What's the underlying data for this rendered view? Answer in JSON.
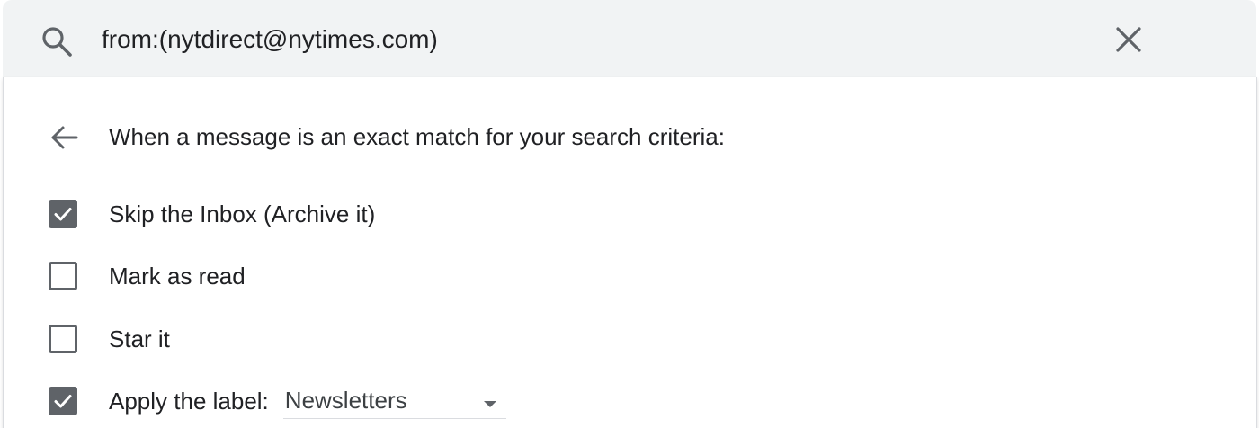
{
  "search": {
    "query": "from:(nytdirect@nytimes.com)",
    "search_icon": "search-icon",
    "clear_icon": "close-icon"
  },
  "filter": {
    "back_icon": "arrow-back-icon",
    "criteria_text": "When a message is an exact match for your search criteria:",
    "options": [
      {
        "label": "Skip the Inbox (Archive it)",
        "checked": true
      },
      {
        "label": "Mark as read",
        "checked": false
      },
      {
        "label": "Star it",
        "checked": false
      },
      {
        "label": "Apply the label:",
        "checked": true
      }
    ],
    "label_select": {
      "value": "Newsletters",
      "icon": "chevron-down-icon"
    }
  },
  "colors": {
    "search_bg": "#f1f3f4",
    "text": "#202124",
    "icon": "#5f6368",
    "divider": "#dadce0"
  }
}
